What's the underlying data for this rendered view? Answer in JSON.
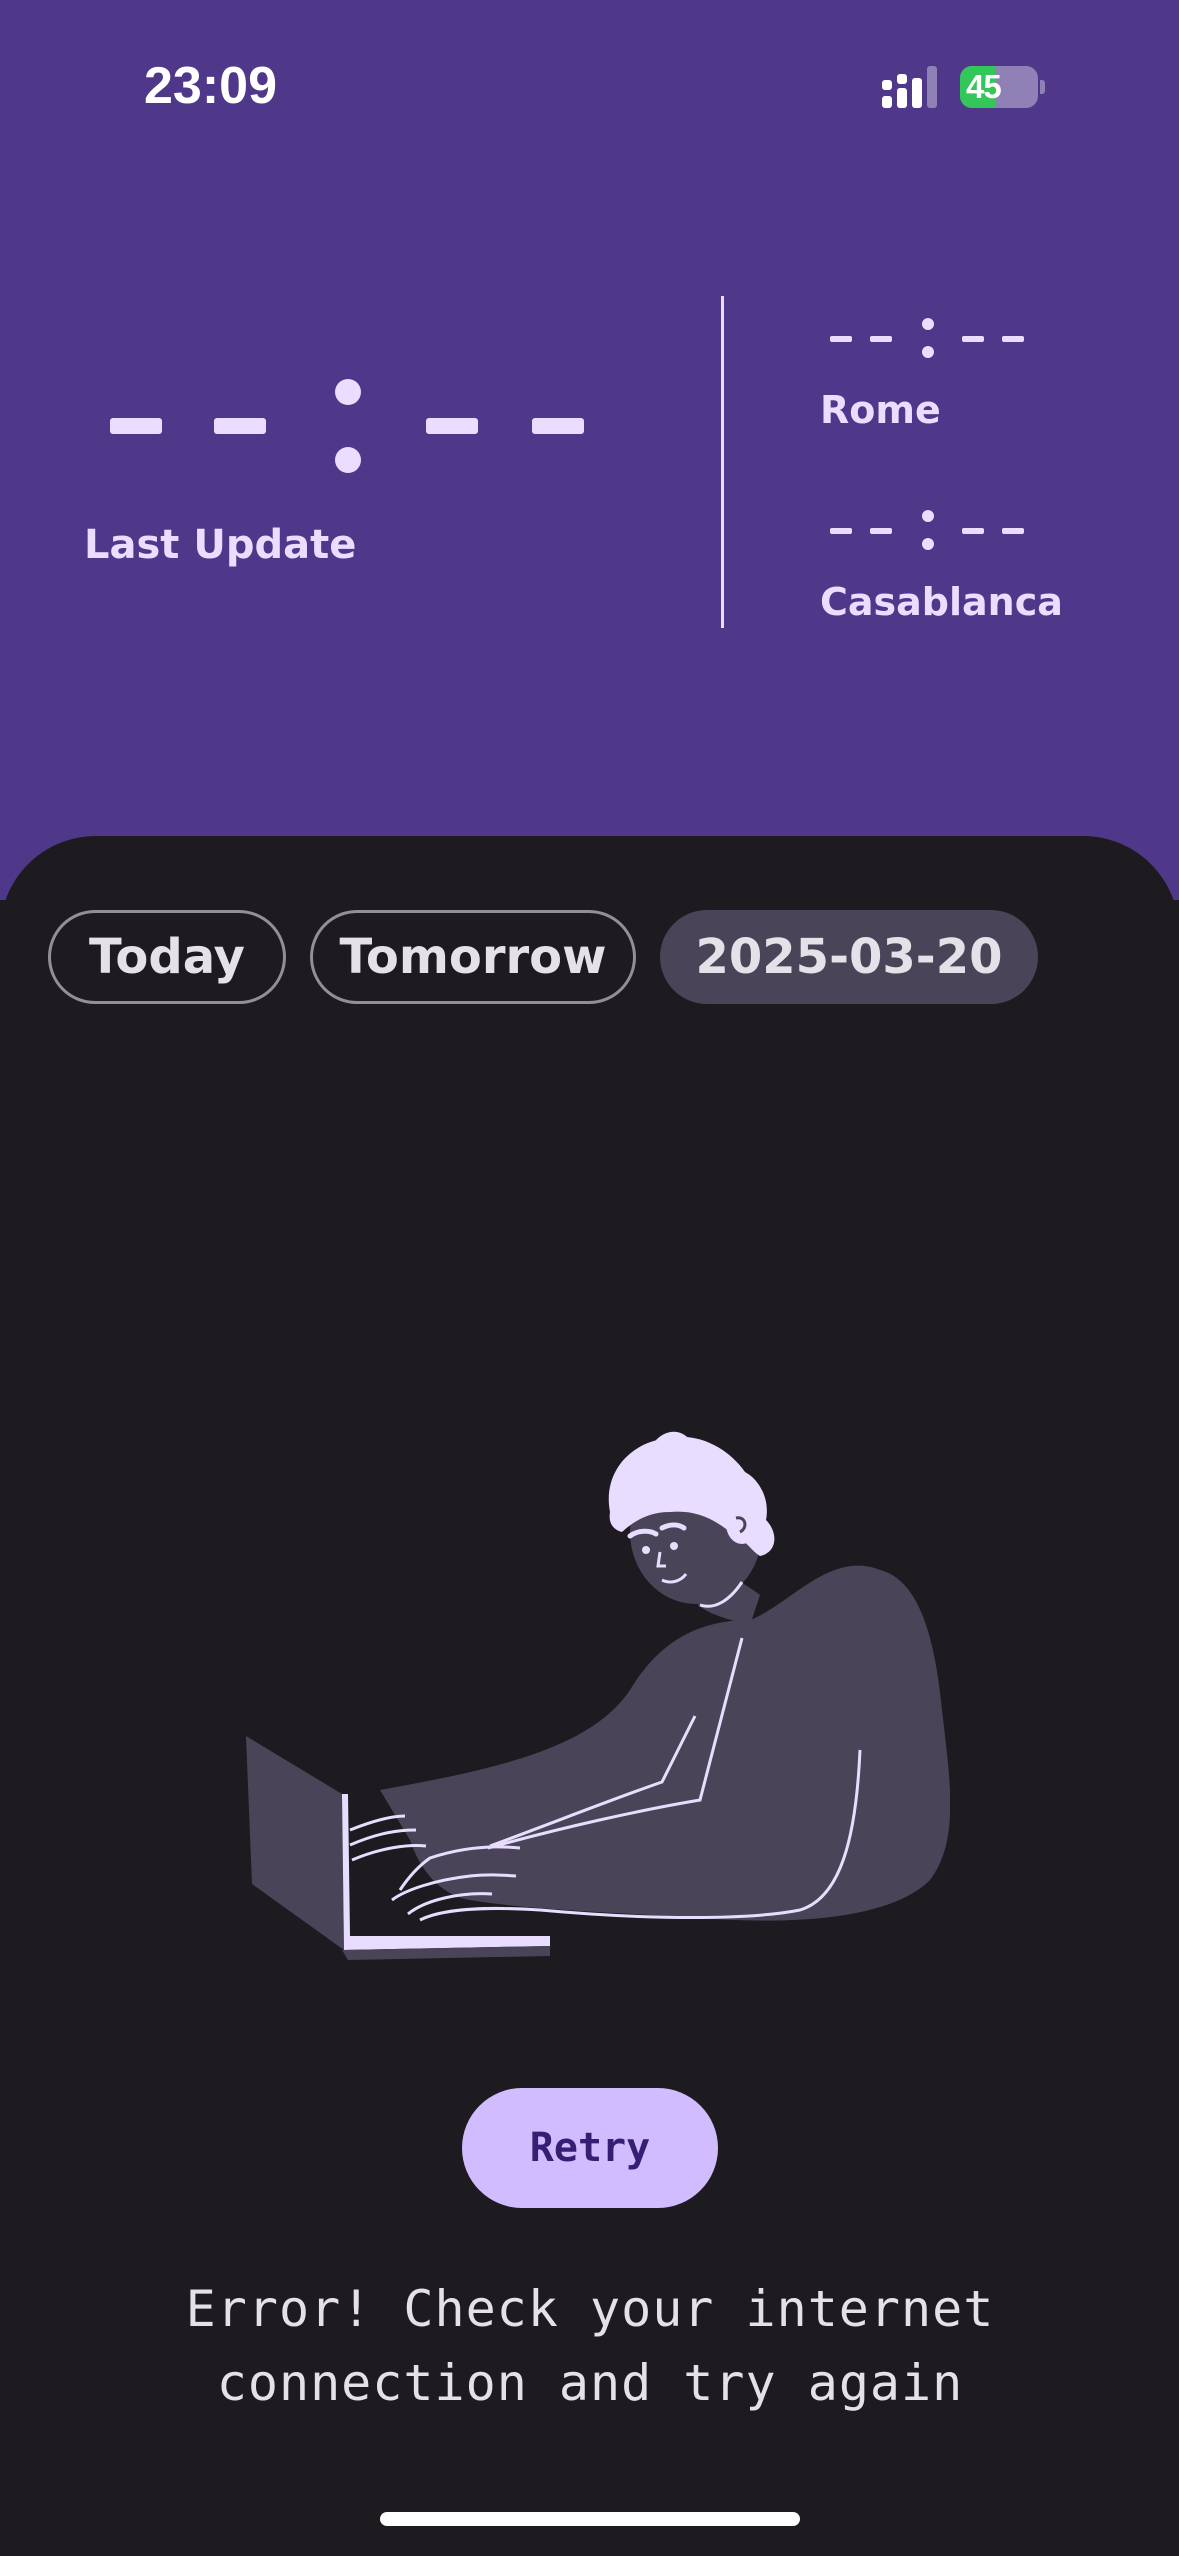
{
  "status_bar": {
    "time": "23:09",
    "battery_level": "45",
    "icons": [
      "cellular-signal-icon",
      "battery-charging-icon"
    ]
  },
  "header": {
    "main_time": "--:--",
    "last_update_label": "Last Update",
    "cities": [
      {
        "time": "--:--",
        "name": "Rome"
      },
      {
        "time": "--:--",
        "name": "Casablanca"
      }
    ]
  },
  "tabs": [
    {
      "label": "Today"
    },
    {
      "label": "Tomorrow"
    },
    {
      "label": "2025-03-20",
      "selected": true
    }
  ],
  "error": {
    "retry_label": "Retry",
    "message": "Error! Check your internet connection and try again"
  },
  "colors": {
    "header_bg": "#4f378a",
    "sheet_bg": "#1d1b20",
    "accent": "#d0bcff",
    "selected_chip": "#4a4458",
    "battery_green": "#33c759"
  }
}
